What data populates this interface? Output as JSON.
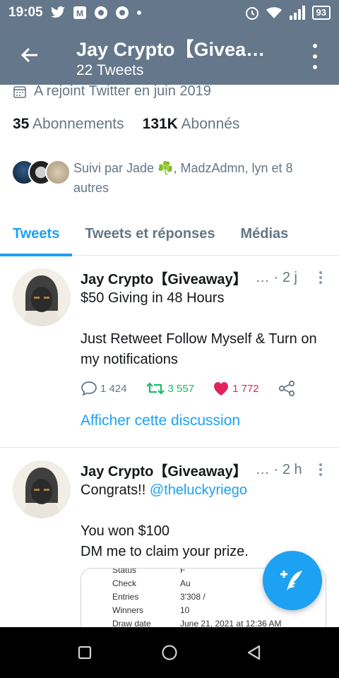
{
  "status_bar": {
    "time": "19:05",
    "battery": "93"
  },
  "header": {
    "title": "Jay Crypto【Givea…",
    "subtitle": "22 Tweets"
  },
  "profile": {
    "joined": "A rejoint Twitter en juin 2019",
    "following_count": "35",
    "following_label": "Abonnements",
    "followers_count": "131K",
    "followers_label": "Abonnés",
    "followed_by": "Suivi par Jade ☘️, MadzAdmn, lyn et 8 autres"
  },
  "tabs": [
    {
      "label": "Tweets",
      "active": true
    },
    {
      "label": "Tweets et réponses",
      "active": false
    },
    {
      "label": "Médias",
      "active": false
    }
  ],
  "tweets": [
    {
      "name": "Jay Crypto【Giveaway】",
      "handle": "…",
      "time": "· 2 j",
      "text": "$50 Giving in 48 Hours\n\nJust Retweet Follow Myself & Turn on my notifications",
      "replies": "1 424",
      "retweets": "3 557",
      "likes": "1 772",
      "show_thread": "Afficher cette discussion"
    },
    {
      "name": "Jay Crypto【Giveaway】",
      "handle": "…",
      "time": "· 2 h",
      "text_before": "Congrats!! ",
      "mention": "@theluckyriego",
      "text_after": "\n\nYou won $100\nDM me to claim your prize.",
      "media_rows": [
        {
          "k": "Status",
          "v": "F"
        },
        {
          "k": "Check",
          "v": "Au"
        },
        {
          "k": "Entries",
          "v": "3'308 /"
        },
        {
          "k": "Winners",
          "v": "10"
        },
        {
          "k": "Draw date",
          "v": "June 21, 2021 at 12:36 AM"
        }
      ]
    }
  ],
  "colors": {
    "header_bg": "#64778b",
    "accent": "#1da1f2",
    "retweet": "#17bf63",
    "like": "#e0245e",
    "muted": "#657786"
  }
}
